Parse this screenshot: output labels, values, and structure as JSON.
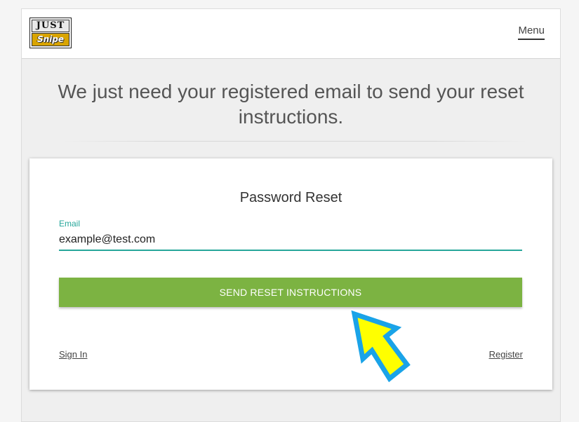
{
  "header": {
    "logo": {
      "top_text": "JUST",
      "bottom_text": "Snipe"
    },
    "menu_label": "Menu"
  },
  "main": {
    "headline": "We just need your registered email to send your reset instructions."
  },
  "form": {
    "title": "Password Reset",
    "email_label": "Email",
    "email_value": "example@test.com",
    "submit_label": "SEND RESET INSTRUCTIONS",
    "sign_in_label": "Sign In",
    "register_label": "Register"
  },
  "colors": {
    "accent": "#26a69a",
    "button": "#7cb342",
    "arrow_fill": "#ffff00",
    "arrow_outline": "#1aa3e8"
  },
  "icons": {
    "annotation": "pointer-arrow-icon"
  }
}
